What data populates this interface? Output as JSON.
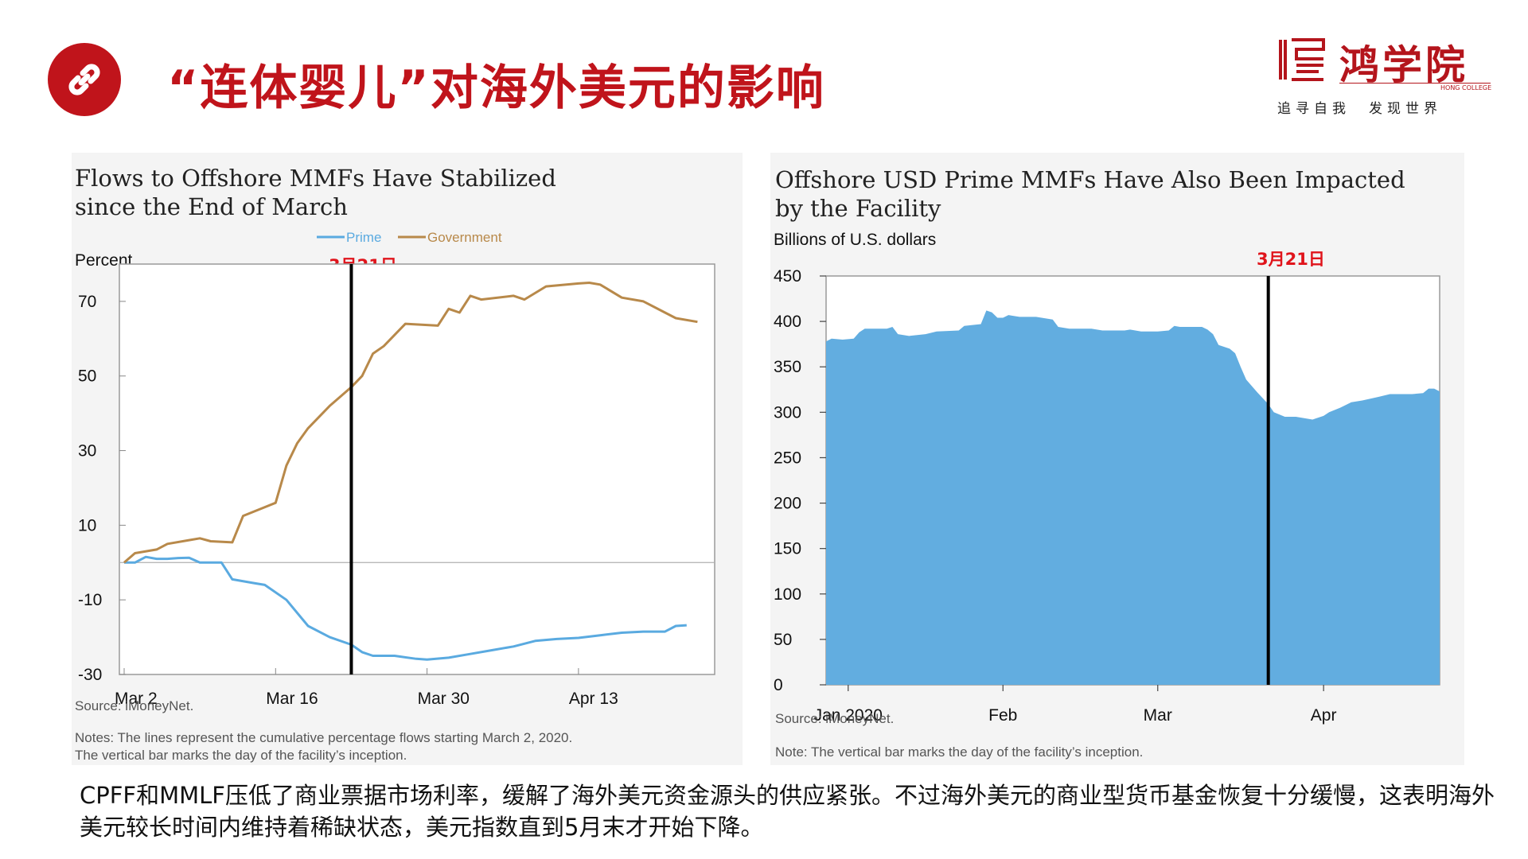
{
  "header": {
    "title": "“连体婴儿”对海外美元的影响",
    "logo": {
      "name": "鸿学院",
      "english": "HONG COLLEGE",
      "slogan": "追寻自我　发现世界"
    }
  },
  "left_panel": {
    "title_line1": "Flows to Offshore MMFs Have Stabilized",
    "title_line2": "since the End of March",
    "y_unit": "Percent",
    "marker_label": "3月21日",
    "source": "Source:  iMoneyNet.",
    "notes_line1": "Notes: The lines represent the cumulative percentage flows starting March 2, 2020.",
    "notes_line2": "The vertical bar marks the day of the facility’s inception."
  },
  "right_panel": {
    "title_line1": "Offshore USD Prime MMFs Have Also Been Impacted",
    "title_line2": "by the Facility",
    "y_unit": "Billions of U.S. dollars",
    "marker_label": "3月21日",
    "source": "Source:  iMoneyNet.",
    "note": "Note: The vertical bar marks the day of the facility’s inception."
  },
  "summary_text": "CPFF和MMLF压低了商业票据市场利率，缓解了海外美元资金源头的供应紧张。不过海外美元的商业型货币基金恢复十分缓慢，这表明海外美元较长时间内维持着稀缺状态，美元指数直到5月末才开始下降。",
  "colors": {
    "accent": "#c0141b",
    "prime": "#5aaae0",
    "government": "#b8894a",
    "area": "#62ade0",
    "marker": "#e0141b"
  },
  "chart_data": [
    {
      "type": "line",
      "title": "Flows to Offshore MMFs Have Stabilized since the End of March",
      "ylabel": "Percent",
      "ylim": [
        -30,
        80
      ],
      "xlim": [
        0,
        54
      ],
      "yticks": [
        70,
        50,
        30,
        10,
        -10,
        -30
      ],
      "xtick_labels": [
        {
          "x": 0,
          "label": "Mar 2"
        },
        {
          "x": 14,
          "label": "Mar 16"
        },
        {
          "x": 28,
          "label": "Mar 30"
        },
        {
          "x": 42,
          "label": "Apr 13"
        }
      ],
      "marker_x": 21,
      "zero_line": true,
      "legend_position": "top",
      "series": [
        {
          "name": "Prime",
          "color": "#5aaae0",
          "points": [
            [
              0,
              0
            ],
            [
              1,
              0
            ],
            [
              2,
              1.5
            ],
            [
              3,
              1
            ],
            [
              4,
              1
            ],
            [
              5,
              1.2
            ],
            [
              6,
              1.3
            ],
            [
              7,
              0
            ],
            [
              9,
              0
            ],
            [
              10,
              -4.5
            ],
            [
              12,
              -5.5
            ],
            [
              13,
              -6
            ],
            [
              15,
              -10
            ],
            [
              17,
              -17
            ],
            [
              19,
              -20
            ],
            [
              21,
              -22
            ],
            [
              22,
              -24
            ],
            [
              23,
              -25
            ],
            [
              25,
              -25
            ],
            [
              27,
              -25.8
            ],
            [
              28,
              -26
            ],
            [
              30,
              -25.5
            ],
            [
              32,
              -24.5
            ],
            [
              34,
              -23.5
            ],
            [
              36,
              -22.5
            ],
            [
              38,
              -21
            ],
            [
              40,
              -20.5
            ],
            [
              42,
              -20.2
            ],
            [
              44,
              -19.5
            ],
            [
              46,
              -18.8
            ],
            [
              48,
              -18.5
            ],
            [
              50,
              -18.5
            ],
            [
              51,
              -17
            ],
            [
              52,
              -16.8
            ]
          ]
        },
        {
          "name": "Government",
          "color": "#b8894a",
          "points": [
            [
              0,
              0
            ],
            [
              1,
              2.5
            ],
            [
              3,
              3.5
            ],
            [
              4,
              5
            ],
            [
              6,
              6
            ],
            [
              7,
              6.5
            ],
            [
              8,
              5.7
            ],
            [
              10,
              5.4
            ],
            [
              11,
              12.5
            ],
            [
              14,
              16
            ],
            [
              15,
              26
            ],
            [
              16,
              32
            ],
            [
              17,
              36
            ],
            [
              19,
              42
            ],
            [
              21,
              47
            ],
            [
              22,
              50
            ],
            [
              23,
              56
            ],
            [
              24,
              58
            ],
            [
              26,
              64
            ],
            [
              29,
              63.5
            ],
            [
              30,
              68
            ],
            [
              31,
              67
            ],
            [
              32,
              71.5
            ],
            [
              33,
              70.5
            ],
            [
              36,
              71.5
            ],
            [
              37,
              70.5
            ],
            [
              39,
              74
            ],
            [
              42,
              74.8
            ],
            [
              43,
              75
            ],
            [
              44,
              74.5
            ],
            [
              46,
              71
            ],
            [
              48,
              70
            ],
            [
              50,
              67
            ],
            [
              51,
              65.5
            ],
            [
              53,
              64.5
            ]
          ]
        }
      ]
    },
    {
      "type": "area",
      "title": "Offshore USD Prime MMFs Have Also Been Impacted by the Facility",
      "ylabel": "Billions of U.S. dollars",
      "ylim": [
        0,
        450
      ],
      "xlim": [
        0,
        111
      ],
      "yticks": [
        450,
        400,
        350,
        300,
        250,
        200,
        150,
        100,
        50,
        0
      ],
      "xtick_labels": [
        {
          "x": 4,
          "label": "Jan 2020"
        },
        {
          "x": 32,
          "label": "Feb"
        },
        {
          "x": 60,
          "label": "Mar"
        },
        {
          "x": 90,
          "label": "Apr"
        }
      ],
      "marker_x": 80,
      "series": [
        {
          "name": "Offshore USD Prime MMFs",
          "color": "#62ade0",
          "points": [
            [
              0,
              378
            ],
            [
              1,
              381
            ],
            [
              3,
              380
            ],
            [
              5,
              381
            ],
            [
              6,
              388
            ],
            [
              7,
              392
            ],
            [
              11,
              392
            ],
            [
              12,
              394
            ],
            [
              13,
              386
            ],
            [
              15,
              384
            ],
            [
              18,
              386
            ],
            [
              20,
              389
            ],
            [
              24,
              390
            ],
            [
              25,
              395
            ],
            [
              28,
              397
            ],
            [
              29,
              412
            ],
            [
              30,
              410
            ],
            [
              31,
              404
            ],
            [
              32,
              404
            ],
            [
              33,
              407
            ],
            [
              35,
              405
            ],
            [
              38,
              405
            ],
            [
              41,
              402
            ],
            [
              42,
              394
            ],
            [
              44,
              392
            ],
            [
              48,
              392
            ],
            [
              50,
              390
            ],
            [
              54,
              390
            ],
            [
              55,
              391
            ],
            [
              57,
              389
            ],
            [
              60,
              389
            ],
            [
              62,
              390
            ],
            [
              63,
              395
            ],
            [
              64,
              394
            ],
            [
              68,
              394
            ],
            [
              69,
              391
            ],
            [
              70,
              386
            ],
            [
              71,
              374
            ],
            [
              73,
              370
            ],
            [
              74,
              365
            ],
            [
              75,
              350
            ],
            [
              76,
              336
            ],
            [
              78,
              322
            ],
            [
              80,
              309
            ],
            [
              81,
              300
            ],
            [
              83,
              295
            ],
            [
              85,
              295
            ],
            [
              88,
              292
            ],
            [
              90,
              296
            ],
            [
              91,
              300
            ],
            [
              93,
              305
            ],
            [
              95,
              311
            ],
            [
              97,
              313
            ],
            [
              100,
              317
            ],
            [
              102,
              320
            ],
            [
              104,
              320
            ],
            [
              106,
              320
            ],
            [
              108,
              321
            ],
            [
              109,
              326
            ],
            [
              110,
              326
            ],
            [
              111,
              323
            ]
          ]
        }
      ]
    }
  ]
}
